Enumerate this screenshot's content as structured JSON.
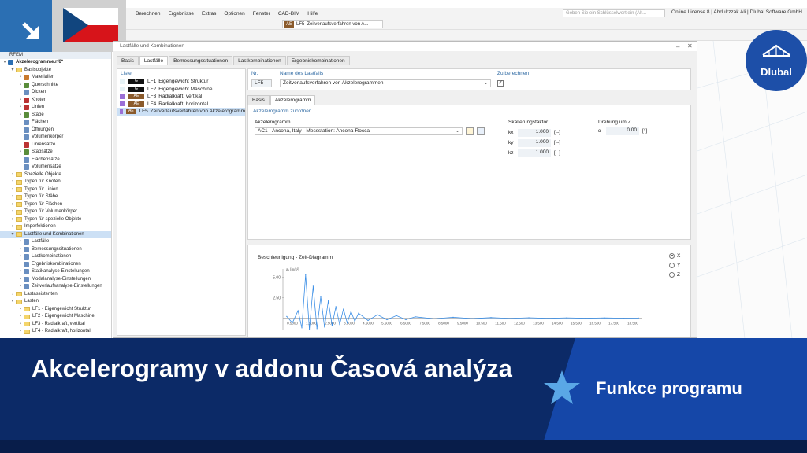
{
  "flag_label": "",
  "menubar": {
    "items": [
      "Berechnen",
      "Ergebnisse",
      "Extras",
      "Optionen",
      "Fenster",
      "CAD-BIM",
      "Hilfe"
    ],
    "search_placeholder": "Geben Sie ein Schlüsselwort ein (Alt...",
    "license": "Online License 8 | Abdulrzzak Ali | Dlubal Software GmbH"
  },
  "toolbar": {
    "lc_type": "AE",
    "lc_id": "LF5",
    "lc_name": "Zeitverlaufsverfahren von A..."
  },
  "navigator": {
    "header": "RFEM",
    "items": [
      {
        "label": "Akzelerogramme.rf6*",
        "indent": 0,
        "arrow": "▾",
        "kind": "file"
      },
      {
        "label": "Basisobjekte",
        "indent": 1,
        "arrow": "▾",
        "kind": "folder"
      },
      {
        "label": "Materialien",
        "indent": 2,
        "arrow": "›",
        "kind": "icon",
        "color": "#c97a2d"
      },
      {
        "label": "Querschnitte",
        "indent": 2,
        "arrow": "›",
        "kind": "icon",
        "color": "#5a8d3a"
      },
      {
        "label": "Dicken",
        "indent": 2,
        "arrow": "",
        "kind": "icon",
        "color": "#6a8fc0"
      },
      {
        "label": "Knoten",
        "indent": 2,
        "arrow": "›",
        "kind": "icon",
        "color": "#b33"
      },
      {
        "label": "Linien",
        "indent": 2,
        "arrow": "›",
        "kind": "icon",
        "color": "#b33"
      },
      {
        "label": "Stäbe",
        "indent": 2,
        "arrow": "›",
        "kind": "icon",
        "color": "#5a8d3a"
      },
      {
        "label": "Flächen",
        "indent": 2,
        "arrow": "",
        "kind": "icon",
        "color": "#6a8fc0"
      },
      {
        "label": "Öffnungen",
        "indent": 2,
        "arrow": "",
        "kind": "icon",
        "color": "#6a8fc0"
      },
      {
        "label": "Volumenkörper",
        "indent": 2,
        "arrow": "",
        "kind": "icon",
        "color": "#6a8fc0"
      },
      {
        "label": "Liniensätze",
        "indent": 2,
        "arrow": "",
        "kind": "icon",
        "color": "#b33"
      },
      {
        "label": "Stabsätze",
        "indent": 2,
        "arrow": "›",
        "kind": "icon",
        "color": "#5a8d3a"
      },
      {
        "label": "Flächensätze",
        "indent": 2,
        "arrow": "",
        "kind": "icon",
        "color": "#6a8fc0"
      },
      {
        "label": "Volumensätze",
        "indent": 2,
        "arrow": "",
        "kind": "icon",
        "color": "#6a8fc0"
      },
      {
        "label": "Spezielle Objekte",
        "indent": 1,
        "arrow": "›",
        "kind": "folder"
      },
      {
        "label": "Typen für Knoten",
        "indent": 1,
        "arrow": "›",
        "kind": "folder"
      },
      {
        "label": "Typen für Linien",
        "indent": 1,
        "arrow": "›",
        "kind": "folder"
      },
      {
        "label": "Typen für Stäbe",
        "indent": 1,
        "arrow": "›",
        "kind": "folder"
      },
      {
        "label": "Typen für Flächen",
        "indent": 1,
        "arrow": "›",
        "kind": "folder"
      },
      {
        "label": "Typen für Volumenkörper",
        "indent": 1,
        "arrow": "›",
        "kind": "folder"
      },
      {
        "label": "Typen für spezielle Objekte",
        "indent": 1,
        "arrow": "›",
        "kind": "folder"
      },
      {
        "label": "Imperfektionen",
        "indent": 1,
        "arrow": "›",
        "kind": "folder"
      },
      {
        "label": "Lastfälle und Kombinationen",
        "indent": 1,
        "arrow": "▾",
        "kind": "folder",
        "selected": true
      },
      {
        "label": "Lastfälle",
        "indent": 2,
        "arrow": "›",
        "kind": "icon",
        "color": "#6a8fc0"
      },
      {
        "label": "Bemessungssituationen",
        "indent": 2,
        "arrow": "›",
        "kind": "icon",
        "color": "#6a8fc0"
      },
      {
        "label": "Lastkombinationen",
        "indent": 2,
        "arrow": "›",
        "kind": "icon",
        "color": "#6a8fc0"
      },
      {
        "label": "Ergebniskombinationen",
        "indent": 2,
        "arrow": "",
        "kind": "icon",
        "color": "#6a8fc0"
      },
      {
        "label": "Statikanalyse-Einstellungen",
        "indent": 2,
        "arrow": "›",
        "kind": "icon",
        "color": "#6a8fc0"
      },
      {
        "label": "Modalanalyse-Einstellungen",
        "indent": 2,
        "arrow": "›",
        "kind": "icon",
        "color": "#6a8fc0"
      },
      {
        "label": "Zeitverlaufsanalyse-Einstellungen",
        "indent": 2,
        "arrow": "›",
        "kind": "icon",
        "color": "#6a8fc0"
      },
      {
        "label": "Lastassistenten",
        "indent": 1,
        "arrow": "›",
        "kind": "folder"
      },
      {
        "label": "Lasten",
        "indent": 1,
        "arrow": "▾",
        "kind": "folder"
      },
      {
        "label": "LF1 - Eigengewicht Struktur",
        "indent": 2,
        "arrow": "›",
        "kind": "folder"
      },
      {
        "label": "LF2 - Eigengewicht Maschine",
        "indent": 2,
        "arrow": "›",
        "kind": "folder"
      },
      {
        "label": "LF3 - Radialkraft, vertikal",
        "indent": 2,
        "arrow": "›",
        "kind": "folder"
      },
      {
        "label": "LF4 - Radialkraft, horizontal",
        "indent": 2,
        "arrow": "›",
        "kind": "folder"
      }
    ]
  },
  "dialog": {
    "title": "Lastfälle und Kombinationen",
    "tabs": [
      "Basis",
      "Lastfälle",
      "Bemessungssituationen",
      "Lastkombinationen",
      "Ergebniskombinationen"
    ],
    "active_tab": 1,
    "list_header": "Liste",
    "list": [
      {
        "type": "G",
        "type_color": "#111",
        "swatch": "#e6f2f6",
        "id": "LF1",
        "name": "Eigengewicht Struktur"
      },
      {
        "type": "G",
        "type_color": "#111",
        "swatch": "#e6f2f6",
        "id": "LF2",
        "name": "Eigengewicht Maschine"
      },
      {
        "type": "AE",
        "type_color": "#8a5a2b",
        "swatch": "#9b6fd6",
        "id": "LF3",
        "name": "Radialkraft, vertikal"
      },
      {
        "type": "AE",
        "type_color": "#8a5a2b",
        "swatch": "#9b6fd6",
        "id": "LF4",
        "name": "Radialkraft, horizontal"
      },
      {
        "type": "AE",
        "type_color": "#8a5a2b",
        "swatch": "#9b6fd6",
        "id": "LF5",
        "name": "Zeitverlaufsverfahren von Akzelerogramm",
        "selected": true
      }
    ],
    "no_label": "Nr.",
    "no_value": "LF5",
    "name_label": "Name des Lastfalls",
    "name_value": "Zeitverlaufsverfahren von Akzelerogrammen",
    "calc_label": "Zu berechnen",
    "subtabs": [
      "Basis",
      "Akzelerogramm"
    ],
    "section_label": "Akzelerogramm zuordnen",
    "accel_label": "Akzelerogramm",
    "accel_value": "AC1 - Ancona, Italy - Messstation: Ancona-Rocca",
    "scale_label": "Skalierungsfaktor",
    "scale_rows": [
      {
        "key": "kx",
        "value": "1.000",
        "unit": "[--]"
      },
      {
        "key": "ky",
        "value": "1.000",
        "unit": "[--]"
      },
      {
        "key": "kz",
        "value": "1.000",
        "unit": "[--]"
      }
    ],
    "rot_label": "Drehung um Z",
    "rot_key": "α",
    "rot_value": "0.00",
    "rot_unit": "[°]",
    "chart_title": "Beschleunigung - Zeit-Diagramm",
    "chart_ylabel": "aₓ [m/s²]",
    "radio": [
      "X",
      "Y",
      "Z"
    ],
    "radio_selected": 0
  },
  "chart_data": {
    "type": "line",
    "title": "Beschleunigung - Zeit-Diagramm",
    "ylabel": "aₓ [m/s²]",
    "xlabel": "",
    "y_ticks": [
      "5.00",
      "2.50"
    ],
    "x_ticks": [
      "0.5000",
      "1.5000",
      "2.5000",
      "3.5000",
      "4.5000",
      "5.5000",
      "6.5000",
      "7.5000",
      "8.5000",
      "9.5000",
      "10.500",
      "11.500",
      "12.500",
      "13.500",
      "14.500",
      "15.500",
      "16.500",
      "17.500",
      "18.500"
    ],
    "xlim": [
      0,
      19
    ],
    "ylim": [
      -1.5,
      6
    ],
    "x": [
      0.2,
      0.5,
      0.8,
      1.0,
      1.2,
      1.4,
      1.6,
      1.8,
      2.0,
      2.2,
      2.4,
      2.6,
      2.8,
      3.0,
      3.2,
      3.4,
      3.6,
      3.8,
      4.0,
      4.5,
      5.0,
      5.5,
      6.0,
      6.5,
      7.0,
      8.0,
      9.0,
      10.0,
      11.0,
      12.0,
      13.0,
      14.0,
      15.0,
      16.0,
      17.0,
      18.0,
      18.8
    ],
    "y": [
      0.2,
      -0.6,
      0.9,
      -1.2,
      5.3,
      -1.4,
      3.9,
      -1.3,
      2.6,
      -1.1,
      2.1,
      -0.9,
      1.4,
      -0.8,
      1.1,
      -0.6,
      0.8,
      -0.4,
      0.6,
      -0.3,
      0.4,
      -0.2,
      0.3,
      -0.2,
      0.15,
      -0.1,
      0.1,
      -0.08,
      0.06,
      -0.05,
      0.04,
      -0.04,
      0.03,
      -0.03,
      0.02,
      -0.02,
      0.0
    ],
    "color": "#3a8ee6"
  },
  "banner": {
    "title": "Akcelerogramy v addonu Časová analýza",
    "subtitle": "Funkce programu",
    "logo": "Dlubal"
  },
  "colors": {
    "banner_dark": "#0c2a67",
    "banner_accent": "#1547a8",
    "logo_blue": "#1d4fa8",
    "star": "#5aa7e6"
  }
}
